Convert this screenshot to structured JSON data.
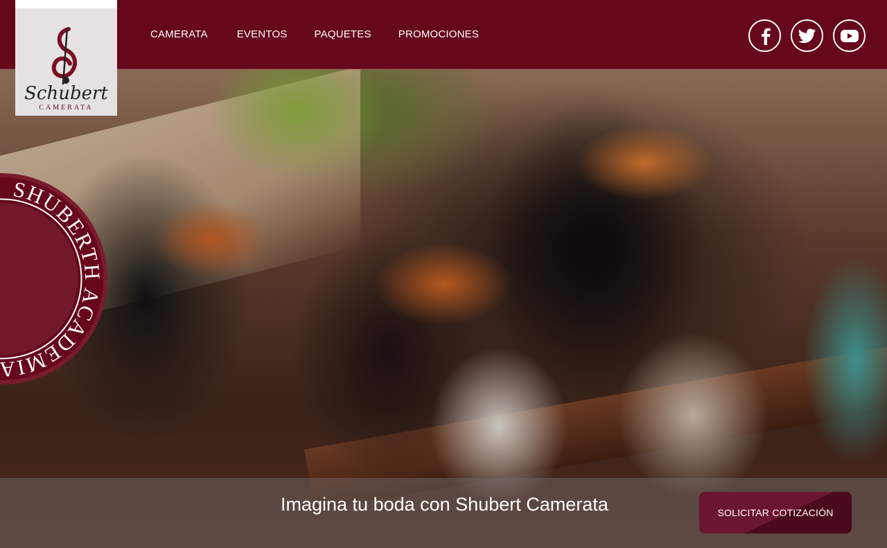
{
  "brand": {
    "script_name": "Schubert",
    "sub_name": "CAMERATA"
  },
  "nav": {
    "items": [
      "CAMERATA",
      "EVENTOS",
      "PAQUETES",
      "PROMOCIONES"
    ]
  },
  "social": {
    "icons": [
      "facebook-icon",
      "twitter-icon",
      "youtube-icon"
    ]
  },
  "badge": {
    "text": "SHUBERTH ACADEMIA"
  },
  "banner": {
    "tagline": "Imagina tu boda con Shubert Camerata",
    "cta_label": "SOLICITAR COTIZACIÓN"
  },
  "colors": {
    "primary": "#66071c",
    "banner_overlay": "rgba(120,110,110,0.45)"
  }
}
